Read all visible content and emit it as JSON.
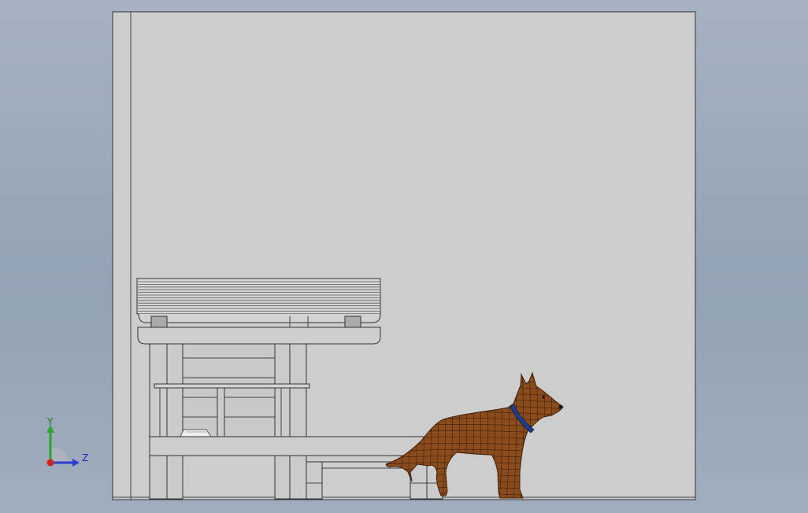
{
  "colors": {
    "background_top": "#a6b2c2",
    "background_bottom": "#93a2b4",
    "drawing_fill": "#cdcdcd",
    "edge": "#333333",
    "part_fill": "#cbcbcb",
    "dog_fill": "#8a4c1c",
    "dog_mesh": "#3e1f08",
    "collar": "#1f3c8c",
    "axis_y": "#2aa82a",
    "axis_z": "#2a3fd0",
    "axis_origin": "#d02020"
  },
  "triad": {
    "y_label": "Y",
    "z_label": "Z"
  },
  "model": {
    "parts": [
      "house-frame",
      "kennel-roof",
      "kennel-body",
      "bench",
      "food-bowl",
      "dog"
    ],
    "icons": [
      "coordinate-triad-icon"
    ]
  }
}
